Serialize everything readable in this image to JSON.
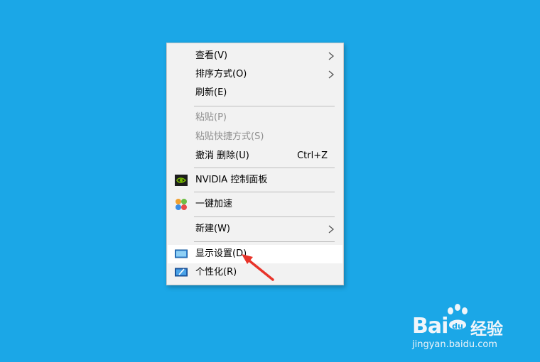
{
  "menu": {
    "items": [
      {
        "label": "查看(V)",
        "has_submenu": true
      },
      {
        "label": "排序方式(O)",
        "has_submenu": true
      },
      {
        "label": "刷新(E)"
      },
      {
        "label": "粘贴(P)",
        "disabled": true
      },
      {
        "label": "粘贴快捷方式(S)",
        "disabled": true
      },
      {
        "label": "撤消 删除(U)",
        "shortcut": "Ctrl+Z"
      },
      {
        "label": "NVIDIA 控制面板",
        "icon": "nvidia-icon"
      },
      {
        "label": "一键加速",
        "icon": "speedup-icon"
      },
      {
        "label": "新建(W)",
        "has_submenu": true
      },
      {
        "label": "显示设置(D)",
        "icon": "display-settings-icon",
        "highlighted": true
      },
      {
        "label": "个性化(R)",
        "icon": "personalize-icon"
      }
    ]
  },
  "watermark": {
    "brand": "Bai",
    "brand_suffix": "经验",
    "url": "jingyan.baidu.com"
  },
  "colors": {
    "desktop": "#1ba7e7",
    "menu_bg": "#f2f2f2",
    "highlight": "#ffffff",
    "arrow": "#e8342a",
    "nvidia_green": "#76b900"
  }
}
